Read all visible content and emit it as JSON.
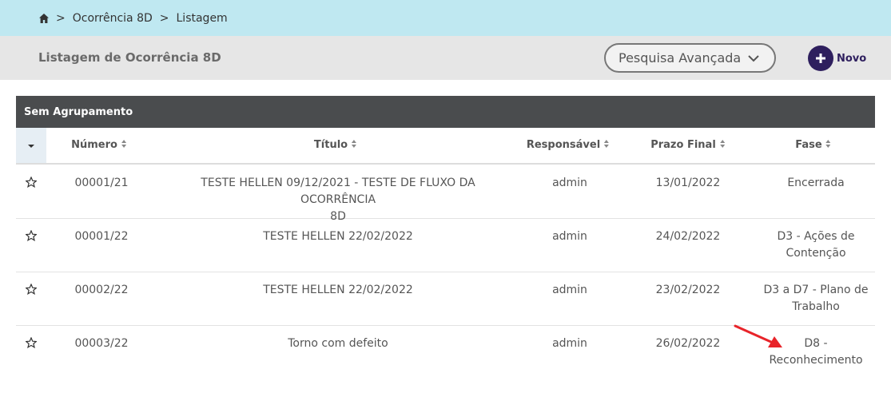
{
  "breadcrumb": {
    "home_icon": "home-icon",
    "separator": ">",
    "items": [
      "Ocorrência 8D",
      "Listagem"
    ]
  },
  "header": {
    "title": "Listagem de Ocorrência 8D",
    "advanced_search_label": "Pesquisa Avançada",
    "new_button_label": "Novo"
  },
  "table": {
    "group_label": "Sem Agrupamento",
    "columns": [
      "Número",
      "Título",
      "Responsável",
      "Prazo Final",
      "Fase"
    ],
    "rows": [
      {
        "numero": "00001/21",
        "titulo_l1": "TESTE HELLEN 09/12/2021 - TESTE DE FLUXO DA OCORRÊNCIA",
        "titulo_l2": "8D",
        "responsavel": "admin",
        "prazo": "13/01/2022",
        "fase_l1": "Encerrada",
        "fase_l2": ""
      },
      {
        "numero": "00001/22",
        "titulo_l1": "TESTE HELLEN 22/02/2022",
        "titulo_l2": "",
        "responsavel": "admin",
        "prazo": "24/02/2022",
        "fase_l1": "D3 - Ações de",
        "fase_l2": "Contenção"
      },
      {
        "numero": "00002/22",
        "titulo_l1": "TESTE HELLEN 22/02/2022",
        "titulo_l2": "",
        "responsavel": "admin",
        "prazo": "23/02/2022",
        "fase_l1": "D3 a D7 - Plano de",
        "fase_l2": "Trabalho"
      },
      {
        "numero": "00003/22",
        "titulo_l1": "Torno com defeito",
        "titulo_l2": "",
        "responsavel": "admin",
        "prazo": "26/02/2022",
        "fase_l1": "D8 -",
        "fase_l2": "Reconhecimento"
      }
    ]
  },
  "colors": {
    "breadcrumb_bg": "#bfe8f1",
    "header_bg": "#e6e6e6",
    "group_bg": "#4a4c4e",
    "accent": "#2e1f5e",
    "annotation_arrow": "#e8242a"
  }
}
